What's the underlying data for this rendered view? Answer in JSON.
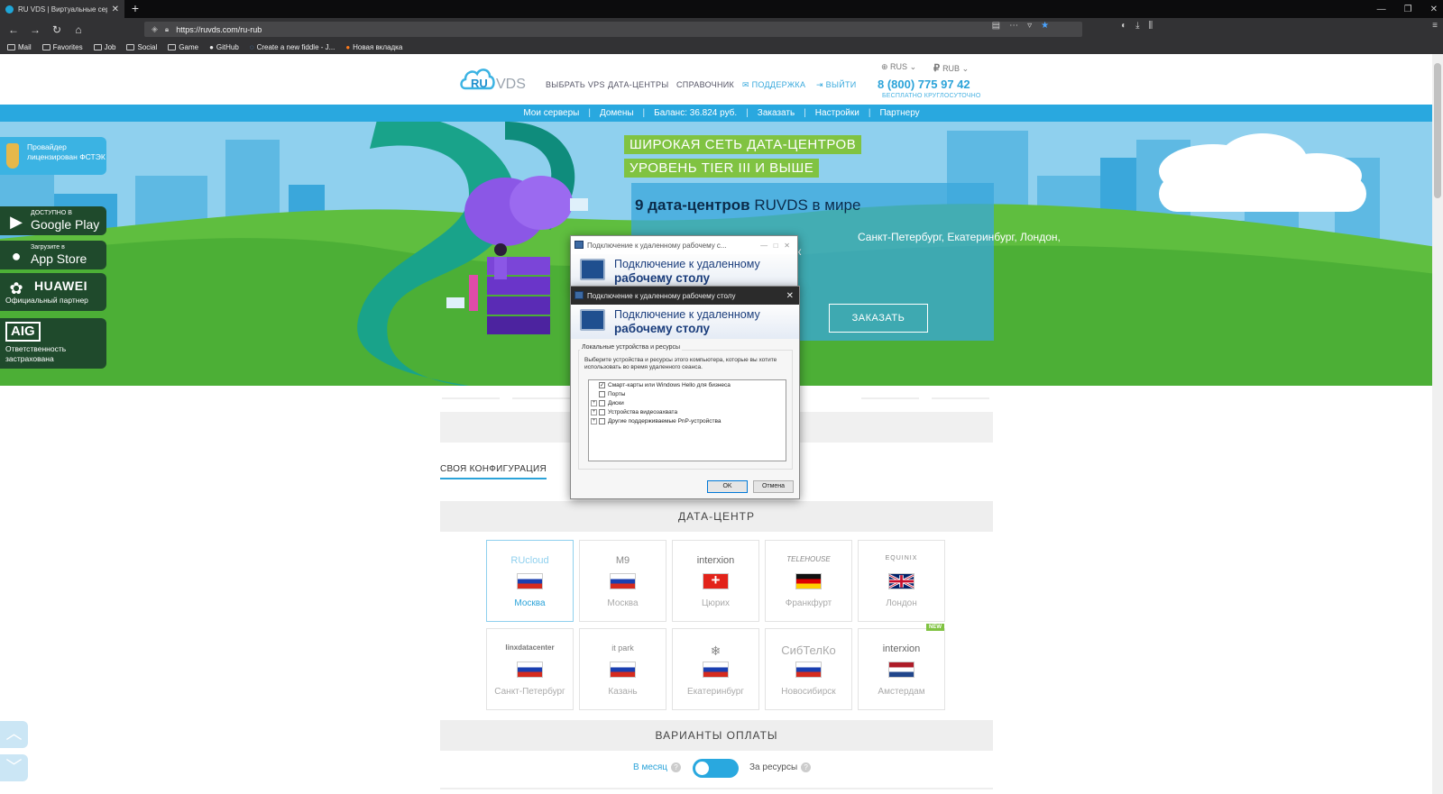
{
  "browser": {
    "tab_title": "RU VDS | Виртуальные серве...",
    "url": "https://ruvds.com/ru-rub",
    "bookmarks": [
      "Mail",
      "Favorites",
      "Job",
      "Social",
      "Game",
      "GitHub",
      "Create a new fiddle - J...",
      "Новая вкладка"
    ]
  },
  "site": {
    "nav": [
      "ВЫБРАТЬ VPS",
      "ДАТА-ЦЕНТРЫ",
      "СПРАВОЧНИК",
      "ПОДДЕРЖКА",
      "ВЫЙТИ"
    ],
    "lang": "RUS",
    "currency": "RUB",
    "phone": "8 (800) 775 97 42",
    "phone_sub": "БЕСПЛАТНО КРУГЛОСУТОЧНО",
    "subnav": [
      "Мои серверы",
      "Домены",
      "Баланс: 36.824 руб.",
      "Заказать",
      "Настройки",
      "Партнеру"
    ]
  },
  "hero": {
    "highlight1": "ШИРОКАЯ СЕТЬ ДАТА-ЦЕНТРОВ",
    "highlight2": "УРОВЕНЬ TIER III И ВЫШЕ",
    "title_bold": "9 дата-центров",
    "title_rest": " RUVDS в мире",
    "subtitle": "Санкт-Петербург, Екатеринбург, Лондон,",
    "subtitle_tail": "к",
    "order_button": "ЗАКАЗАТЬ"
  },
  "side": {
    "fstek": "Провайдер лицензирован ФСТЭК",
    "google_small": "ДОСТУПНО В",
    "google_big": "Google Play",
    "apple_small": "Загрузите в",
    "apple_big": "App Store",
    "huawei_big": "HUAWEI",
    "huawei_small": "Официальный партнер",
    "aig_big": "AIG",
    "aig_small": "Ответственность застрахована"
  },
  "config": {
    "tab": "СВОЯ КОНФИГУРАЦИЯ",
    "dc_title": "ДАТА-ЦЕНТР",
    "datacenters": [
      {
        "brand": "RUcloud",
        "city": "Москва",
        "flag": "ru"
      },
      {
        "brand": "M9",
        "city": "Москва",
        "flag": "ru"
      },
      {
        "brand": "interxion",
        "city": "Цюрих",
        "flag": "ch"
      },
      {
        "brand": "TELEHOUSE",
        "city": "Франкфурт",
        "flag": "de"
      },
      {
        "brand": "EQUINIX",
        "city": "Лондон",
        "flag": "gb"
      },
      {
        "brand": "linxdatacenter",
        "city": "Санкт-Петербург",
        "flag": "ru"
      },
      {
        "brand": "it park",
        "city": "Казань",
        "flag": "ru"
      },
      {
        "brand": "",
        "city": "Екатеринбург",
        "flag": "ru"
      },
      {
        "brand": "СибТелКо",
        "city": "Новосибирск",
        "flag": "ru"
      },
      {
        "brand": "interxion",
        "city": "Амстердам",
        "flag": "nl"
      }
    ],
    "new_badge": "NEW",
    "pay_title": "ВАРИАНТЫ ОПЛАТЫ",
    "pay_month": "В месяц",
    "pay_resources": "За ресурсы"
  },
  "dialog_back": {
    "title": "Подключение к удаленному рабочему с...",
    "banner1": "Подключение к удаленному",
    "banner2": "рабочему столу"
  },
  "dialog_front": {
    "title": "Подключение к удаленному рабочему столу",
    "banner1": "Подключение к удаленному",
    "banner2": "рабочему столу",
    "group_label": "Локальные устройства и ресурсы",
    "description": "Выберите устройства и ресурсы этого компьютера, которые вы хотите использовать во время удаленного сеанса.",
    "items": [
      {
        "label": "Смарт-карты или Windows Hello для бизнеса",
        "checked": true,
        "expand": false
      },
      {
        "label": "Порты",
        "checked": false,
        "expand": false
      },
      {
        "label": "Диски",
        "checked": false,
        "expand": true
      },
      {
        "label": "Устройства видеозахвата",
        "checked": false,
        "expand": true
      },
      {
        "label": "Другие поддерживаемые PnP-устройства",
        "checked": false,
        "expand": true
      }
    ],
    "ok": "OK",
    "cancel": "Отмена"
  }
}
